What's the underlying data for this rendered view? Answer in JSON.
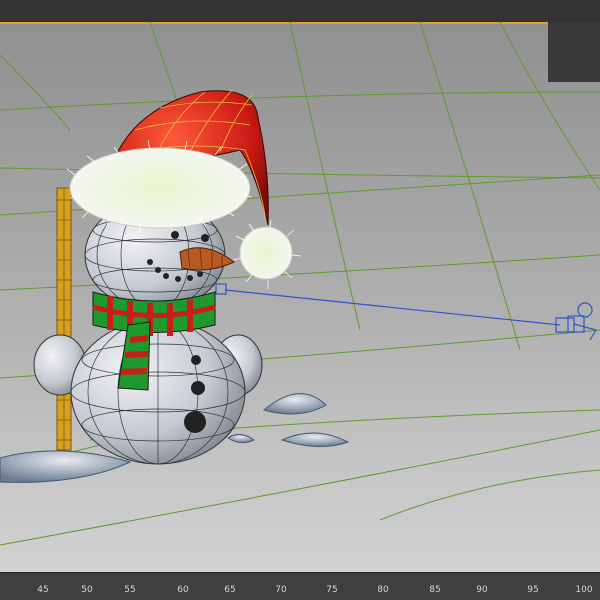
{
  "viewport": {
    "name": "perspective-viewport",
    "scene": "snowman-with-santa-hat",
    "colors": {
      "grid": "#5f9a2a",
      "hat": "#cc1b14",
      "wire": "#e8c23a",
      "body": "#c9ccd2",
      "scarf_green": "#1e9a2c",
      "scarf_red": "#c81e16",
      "broom": "#d9a020",
      "carrot": "#b85a22",
      "link": "#2a56c8"
    }
  },
  "timeline": {
    "ticks": [
      "45",
      "50",
      "55",
      "60",
      "65",
      "70",
      "75",
      "80",
      "85",
      "90",
      "95",
      "100"
    ]
  }
}
